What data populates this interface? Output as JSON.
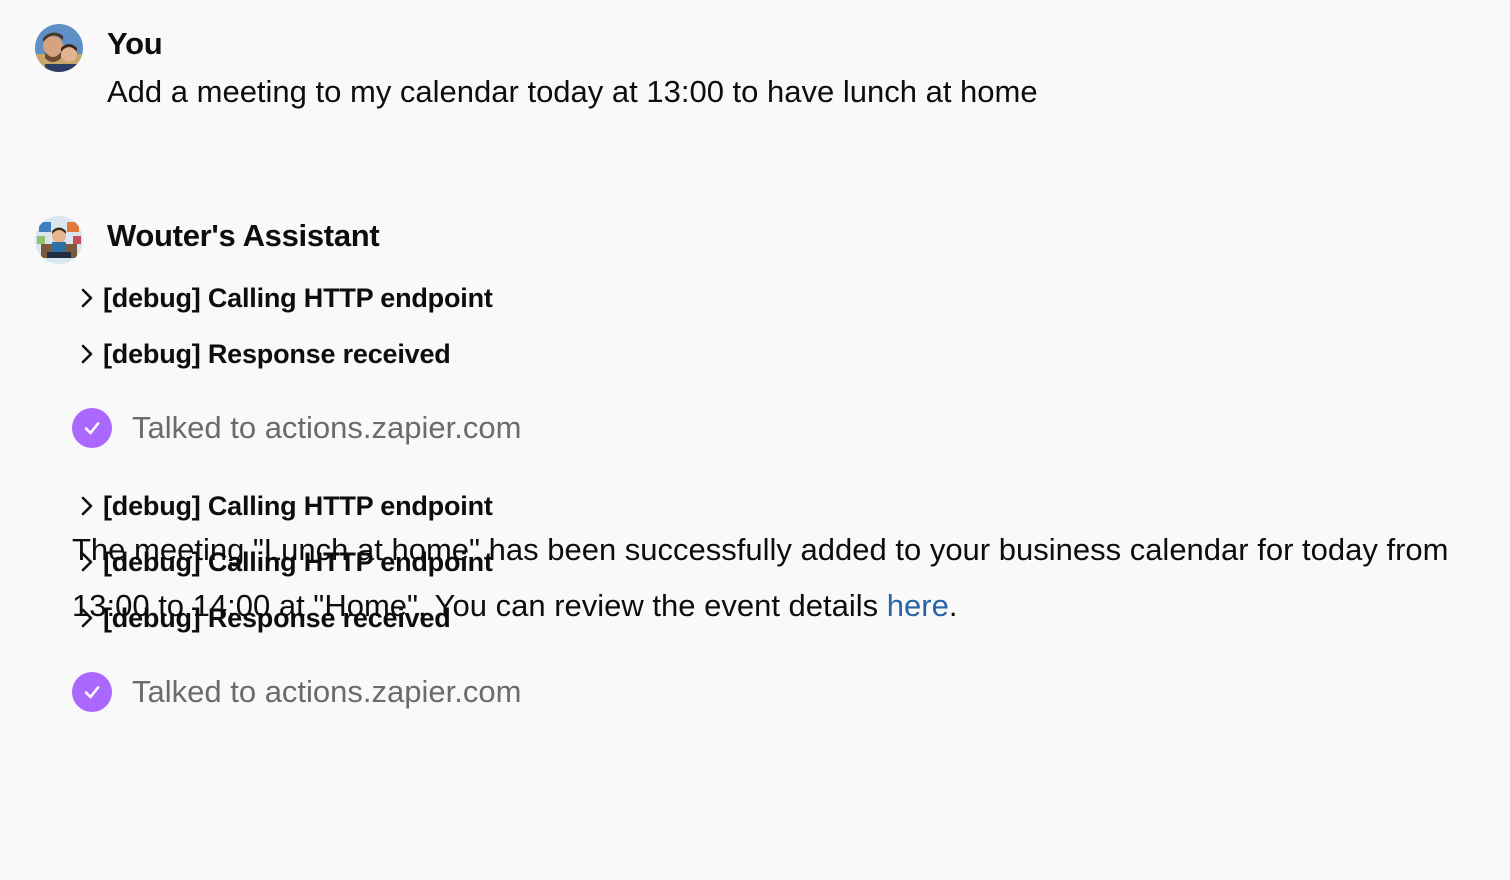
{
  "user_message": {
    "author": "You",
    "text": "Add a meeting to my calendar today at 13:00 to have lunch at home",
    "avatar_icon": "user-photo-avatar"
  },
  "assistant_message": {
    "author": "Wouter's Assistant",
    "avatar_icon": "assistant-illustration-avatar",
    "debug_group_1": [
      {
        "label": "[debug] Calling HTTP endpoint"
      },
      {
        "label": "[debug] Response received"
      }
    ],
    "action_1": {
      "text": "Talked to actions.zapier.com",
      "icon": "check-circle-icon"
    },
    "debug_group_2": [
      {
        "label": "[debug] Calling HTTP endpoint"
      },
      {
        "label": "[debug] Calling HTTP endpoint"
      },
      {
        "label": "[debug] Response received"
      }
    ],
    "action_2": {
      "text": "Talked to actions.zapier.com",
      "icon": "check-circle-icon"
    },
    "reply": {
      "text_before": "The meeting \"Lunch at home\" has been successfully added to your business calendar for today from 13:00 to 14:00 at \"Home\". You can review the event details ",
      "link_text": "here",
      "text_after": "."
    }
  },
  "colors": {
    "background": "#f9f9f9",
    "check_badge": "#ab68ff",
    "muted_text": "#6b6b6b",
    "link": "#2964aa"
  }
}
